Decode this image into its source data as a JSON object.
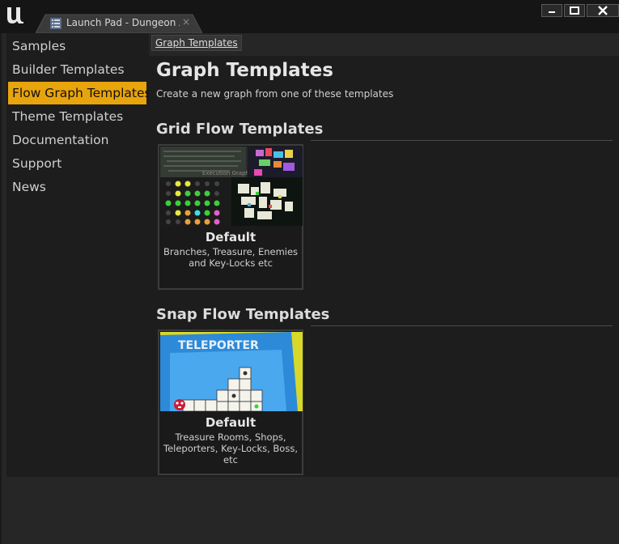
{
  "window": {
    "tab_title": "Launch Pad - Dungeon A",
    "tab_close": "×",
    "controls": {
      "minimize": "minimize-icon",
      "maximize": "maximize-icon",
      "close": "close-icon"
    }
  },
  "sidebar": {
    "items": [
      {
        "label": "Samples",
        "active": false
      },
      {
        "label": "Builder Templates",
        "active": false
      },
      {
        "label": "Flow Graph Templates",
        "active": true
      },
      {
        "label": "Theme Templates",
        "active": false
      },
      {
        "label": "Documentation",
        "active": false
      },
      {
        "label": "Support",
        "active": false
      },
      {
        "label": "News",
        "active": false
      }
    ],
    "active_color": "#e8a40c"
  },
  "breadcrumb": {
    "label": "Graph Templates"
  },
  "page": {
    "title": "Graph Templates",
    "subtitle": "Create a new graph from one of these templates"
  },
  "sections": [
    {
      "title": "Grid Flow Templates",
      "cards": [
        {
          "title": "Default",
          "description": "Branches, Treasure, Enemies and Key-Locks etc",
          "thumb_caption": "Execution Graph"
        }
      ]
    },
    {
      "title": "Snap Flow Templates",
      "cards": [
        {
          "title": "Default",
          "description": "Treasure Rooms, Shops, Teleporters, Key-Locks, Boss, etc",
          "thumb_caption": "TELEPORTER"
        }
      ]
    }
  ]
}
